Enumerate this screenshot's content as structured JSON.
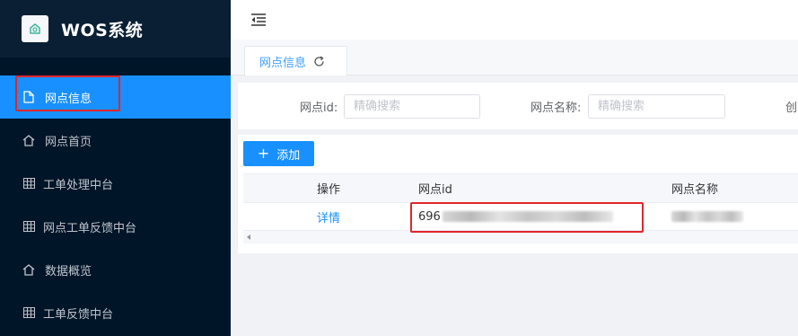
{
  "brand": {
    "title": "WOS系统",
    "logo_icon": "mail-icon"
  },
  "sidebar": {
    "items": [
      {
        "label": "网点信息",
        "icon": "document-icon",
        "active": true
      },
      {
        "label": "网点首页",
        "icon": "home-icon",
        "active": false
      },
      {
        "label": "工单处理中台",
        "icon": "grid-icon",
        "active": false
      },
      {
        "label": "网点工单反馈中台",
        "icon": "grid-icon",
        "active": false
      },
      {
        "label": "数据概览",
        "icon": "home-icon",
        "active": false
      },
      {
        "label": "工单反馈中台",
        "icon": "grid-icon",
        "active": false
      }
    ]
  },
  "topbar": {
    "toggle_icon": "menu-fold-icon"
  },
  "tabs": [
    {
      "label": "网点信息",
      "icon": "refresh-icon"
    }
  ],
  "search": {
    "fields": [
      {
        "label": "网点id:",
        "placeholder": "精确搜索",
        "value": ""
      },
      {
        "label": "网点名称:",
        "placeholder": "精确搜索",
        "value": ""
      },
      {
        "label": "创",
        "placeholder": "",
        "value": ""
      }
    ]
  },
  "toolbar": {
    "add_label": "添加"
  },
  "table": {
    "columns": [
      "操作",
      "网点id",
      "网点名称"
    ],
    "rows": [
      {
        "action": "详情",
        "id_prefix": "696",
        "name": ""
      }
    ]
  },
  "colors": {
    "sidebar_bg": "#001528",
    "accent": "#1890ff",
    "highlight": "#e0262b"
  }
}
